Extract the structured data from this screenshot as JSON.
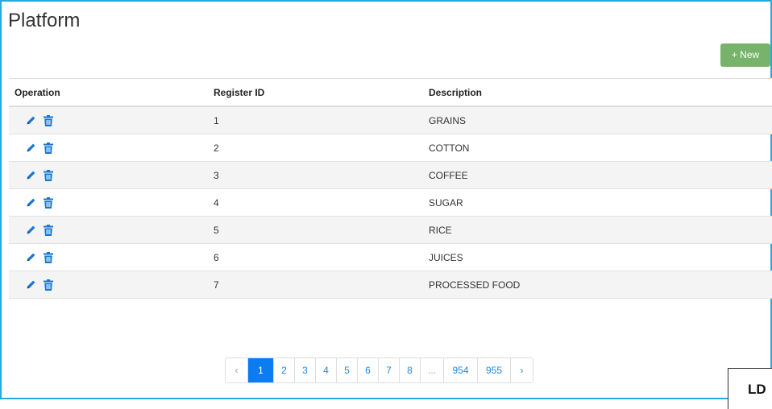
{
  "page": {
    "title": "Platform"
  },
  "toolbar": {
    "new_label": "+ New"
  },
  "table": {
    "headers": {
      "operation": "Operation",
      "register_id": "Register ID",
      "description": "Description"
    },
    "rows": [
      {
        "id": "1",
        "description": "GRAINS"
      },
      {
        "id": "2",
        "description": "COTTON"
      },
      {
        "id": "3",
        "description": "COFFEE"
      },
      {
        "id": "4",
        "description": "SUGAR"
      },
      {
        "id": "5",
        "description": "RICE"
      },
      {
        "id": "6",
        "description": "JUICES"
      },
      {
        "id": "7",
        "description": "PROCESSED FOOD"
      }
    ],
    "row_icons": {
      "edit": "pencil-icon",
      "delete": "trash-icon"
    }
  },
  "pagination": {
    "prev": "‹",
    "pages": [
      "1",
      "2",
      "3",
      "4",
      "5",
      "6",
      "7",
      "8",
      "...",
      "954",
      "955"
    ],
    "next": "›",
    "active_page": "1"
  },
  "corner_label": "LD",
  "colors": {
    "accent": "#0b7cf1",
    "new_button": "#78b36b",
    "frame_border": "#29a8e0",
    "icon": "#1976d2"
  }
}
